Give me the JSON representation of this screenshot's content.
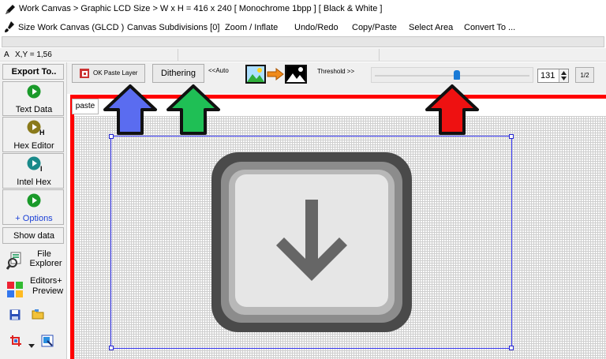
{
  "window": {
    "title": "Work Canvas > Graphic LCD Size > W x H = 416 x 240 [ Monochrome 1bpp ] [ Black & White ]"
  },
  "menu": {
    "items": [
      "Size Work Canvas (GLCD )",
      "Canvas Subdivisions [0]",
      "Zoom / Inflate",
      "Undo/Redo",
      "Copy/Paste",
      "Select Area",
      "Convert To ..."
    ]
  },
  "status": {
    "prefix": "A",
    "coords": "X,Y = 1,56"
  },
  "left_panel": {
    "header": "Export To..",
    "text_data": "Text Data",
    "hex_editor": "Hex Editor",
    "hex_editor_badge": "H",
    "intel_hex": "Intel Hex",
    "intel_hex_badge": "I",
    "options": "+ Options",
    "show_data": "Show data",
    "file_explorer_line1": "File",
    "file_explorer_line2": "Explorer",
    "editors_line1": "Editors+",
    "editors_line2": "Preview"
  },
  "toolbar": {
    "ok_paste": "OK Paste Layer",
    "dithering": "Dithering",
    "auto": "<<Auto",
    "threshold": "Threshold >>",
    "threshold_value": "131",
    "threshold_fraction": 0.53,
    "half": "1/2"
  },
  "canvas": {
    "tab": "paste"
  },
  "colors": {
    "frame": "#ff0000",
    "arrow_blue": "#5a6cf0",
    "arrow_green": "#1fbf55",
    "arrow_red": "#ee1111",
    "play_green": "#1a9a2a",
    "play_olive": "#8a7a1a",
    "play_teal": "#1a8a8a",
    "selection": "#3333ee",
    "slider_thumb": "#1a7ad6"
  },
  "icons": [
    "pencil-icon",
    "brush-icon",
    "play-icon",
    "image-icon",
    "arrow-right-icon",
    "save-icon",
    "folder-icon",
    "crop-icon",
    "resize-icon",
    "down-arrow-key-icon"
  ]
}
